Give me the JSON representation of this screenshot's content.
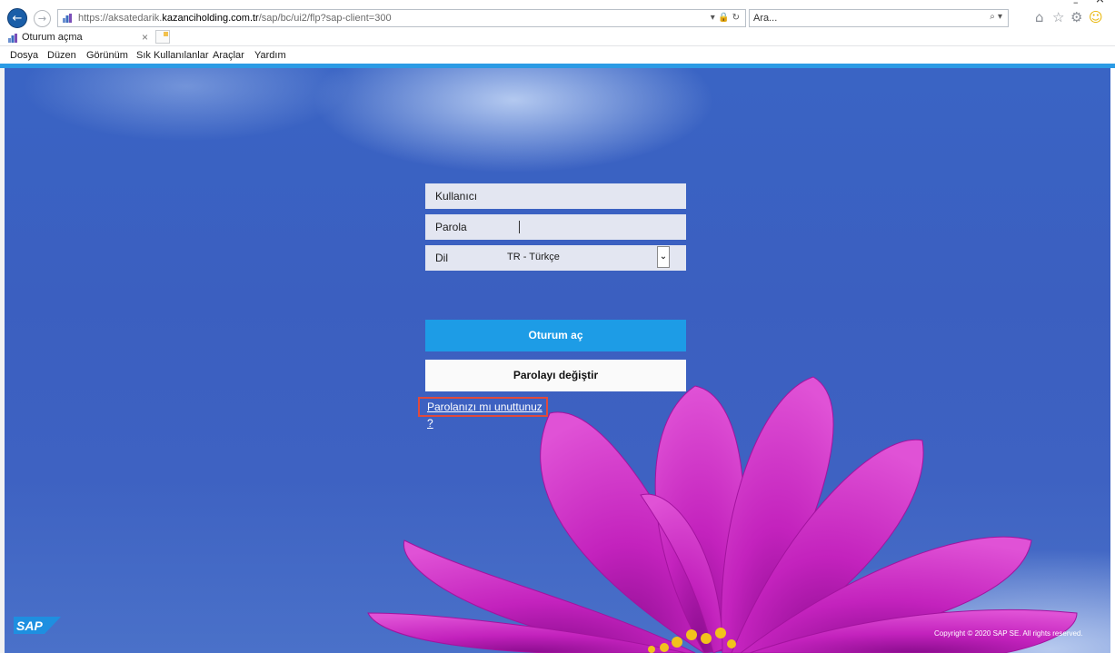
{
  "browser": {
    "url": {
      "prefix": "https://aksatedarik.",
      "domain": "kazanciholding.com.tr",
      "path": "/sap/bc/ui2/flp?sap-client=300"
    },
    "address_tools": "▾ 🔒 ↻",
    "search_placeholder": "Ara...",
    "search_glyph": "⌕ ▾",
    "tab": {
      "title": "Oturum açma",
      "close": "×"
    },
    "menu": [
      "Dosya",
      "Düzen",
      "Görünüm",
      "Sık Kullanılanlar",
      "Araçlar",
      "Yardım"
    ],
    "icons": {
      "back": "←",
      "forward": "→",
      "home": "⌂",
      "favorites": "☆",
      "settings": "⚙",
      "feedback": "☺",
      "minimize": "–",
      "close": "×"
    }
  },
  "login": {
    "username_label": "Kullanıcı",
    "password_label": "Parola",
    "language_label": "Dil",
    "language_value": "TR - Türkçe",
    "dropdown_glyph": "⌄",
    "login_button": "Oturum aç",
    "change_password_button": "Parolayı değiştir",
    "forgot_password_link": "Parolanızı mı unuttunuz ?"
  },
  "footer": {
    "logo": "SAP",
    "copyright": "Copyright © 2020 SAP SE. All rights reserved."
  },
  "colors": {
    "accent": "#1d9ce6",
    "browser_strip": "#2b9be5",
    "highlight_box": "#e04a3c",
    "background": "#3b5fc0",
    "flower": "#c21fb8"
  }
}
